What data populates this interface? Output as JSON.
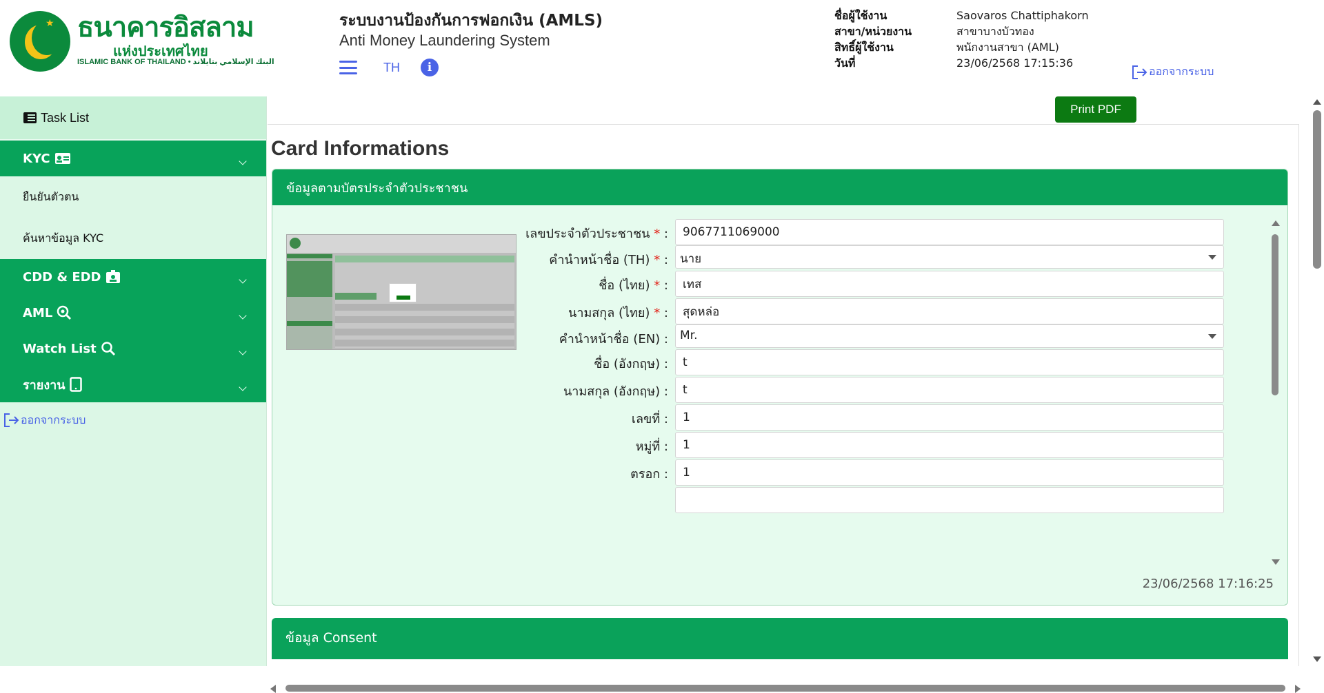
{
  "header": {
    "logo_th": "ธนาคารอิสลาม",
    "logo_sub": "แห่งประเทศไทย",
    "logo_en": "ISLAMIC BANK OF THAILAND • البنك الإسلامي بتايلاند",
    "system_title": "ระบบงานป้องกันการฟอกเงิน (AMLS)",
    "system_subtitle": "Anti Money Laundering System",
    "lang": "TH",
    "user": {
      "username_label": "ชื่อผู้ใช้งาน",
      "username": "Saovaros Chattiphakorn",
      "branch_label": "สาขา/หน่วยงาน",
      "branch": "สาขาบางบัวทอง",
      "role_label": "สิทธิ์ผู้ใช้งาน",
      "role": "พนักงานสาขา (AML)",
      "date_label": "วันที่",
      "date": "23/06/2568 17:15:36"
    },
    "logout": "ออกจากระบบ",
    "colors": {
      "brand_green": "#0aa25a",
      "link_blue": "#4a63e6"
    }
  },
  "sidebar": {
    "task_list": "Task List",
    "groups": [
      {
        "label": "KYC",
        "icon": "id-card-icon"
      },
      {
        "label": "CDD & EDD",
        "icon": "badge-icon"
      },
      {
        "label": "AML",
        "icon": "search-gear-icon"
      },
      {
        "label": "Watch List",
        "icon": "search-icon"
      },
      {
        "label": "รายงาน",
        "icon": "tablet-icon"
      }
    ],
    "kyc_items": [
      "ยืนยันตัวตน",
      "ค้นหาข้อมูล KYC"
    ],
    "logout": "ออกจากระบบ"
  },
  "main": {
    "print_button": "Print PDF",
    "page_title": "Card Informations",
    "card": {
      "header": "ข้อมูลตามบัตรประจำตัวประชาชน",
      "fields": [
        {
          "label": "เลขประจำตัวประชาชน",
          "required": "*",
          "value": "9067711069000",
          "type": "input"
        },
        {
          "label": "คำนำหน้าชื่อ (TH)",
          "required": "*",
          "value": "นาย",
          "type": "select"
        },
        {
          "label": "ชื่อ (ไทย)",
          "required": "*",
          "value": "เทส",
          "type": "input"
        },
        {
          "label": "นามสกุล (ไทย)",
          "required": "*",
          "value": "สุดหล่อ",
          "type": "input"
        },
        {
          "label": "คำนำหน้าชื่อ (EN)",
          "required": "",
          "value": "Mr.",
          "type": "select"
        },
        {
          "label": "ชื่อ (อังกฤษ)",
          "required": "",
          "value": "t",
          "type": "input"
        },
        {
          "label": "นามสกุล (อังกฤษ)",
          "required": "",
          "value": "t",
          "type": "input"
        },
        {
          "label": "เลขที่",
          "required": "",
          "value": "1",
          "type": "input"
        },
        {
          "label": "หมู่ที่",
          "required": "",
          "value": "1",
          "type": "input"
        },
        {
          "label": "ตรอก",
          "required": "",
          "value": "1",
          "type": "input"
        }
      ],
      "timestamp": "23/06/2568 17:16:25"
    },
    "consent_header": "ข้อมูล Consent"
  }
}
